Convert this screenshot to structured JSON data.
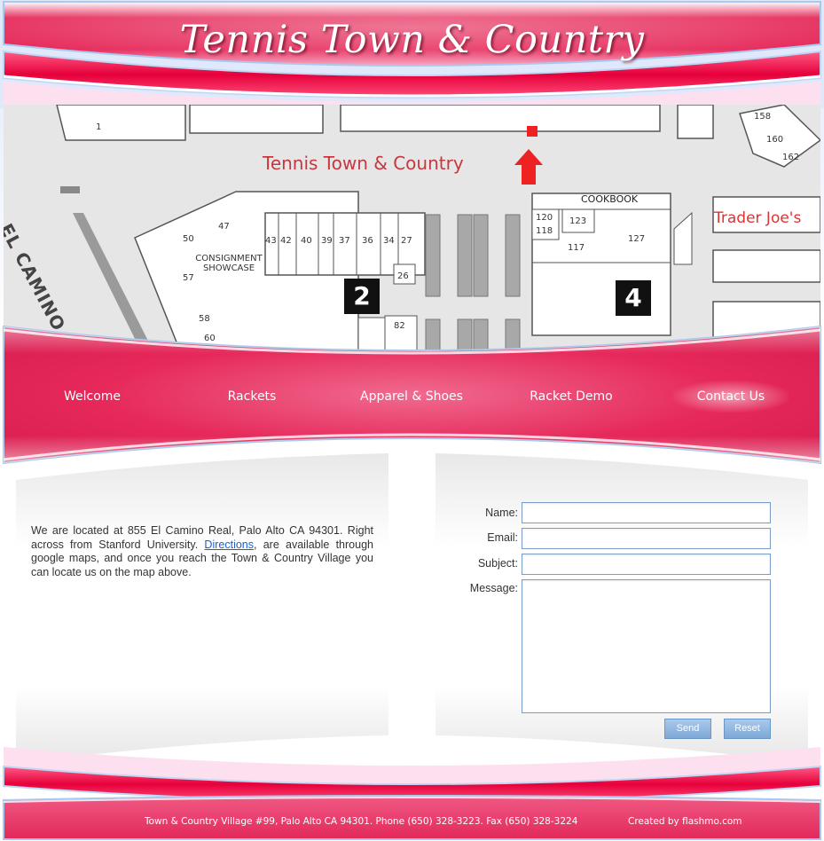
{
  "header": {
    "title": "Tennis Town & Country"
  },
  "map": {
    "store_label": "Tennis Town & Country",
    "trader_joes_label": "Trader Joe's",
    "cookbook_label": "COOKBOOK",
    "consignment_label": "CONSIGNMENT SHOWCASE",
    "road_label": "EL CAMINO",
    "block_2": "2",
    "block_4": "4",
    "units": [
      "1",
      "50",
      "47",
      "43",
      "42",
      "40",
      "39",
      "37",
      "36",
      "34",
      "27",
      "26",
      "57",
      "58",
      "60",
      "82",
      "120",
      "118",
      "123",
      "117",
      "127",
      "158",
      "160",
      "162"
    ]
  },
  "nav": {
    "items": [
      {
        "label": "Welcome"
      },
      {
        "label": "Rackets"
      },
      {
        "label": "Apparel & Shoes"
      },
      {
        "label": "Racket Demo"
      },
      {
        "label": "Contact Us"
      }
    ],
    "active": "Contact Us"
  },
  "about": {
    "text_before": "We are located at 855 El Camino Real, Palo Alto CA 94301. Right across from Stanford University. ",
    "link": "Directions",
    "text_after": ", are available through google maps, and once you reach the Town & Country Village you can locate us on the map above."
  },
  "contact_form": {
    "name_label": "Name:",
    "email_label": "Email:",
    "subject_label": "Subject:",
    "message_label": "Message:",
    "name_value": "",
    "email_value": "",
    "subject_value": "",
    "message_value": "",
    "send_label": "Send",
    "reset_label": "Reset"
  },
  "footer": {
    "address": "Town & Country Village #99, Palo Alto CA 94301. Phone (650) 328-3223. Fax (650) 328-3224",
    "credit": "Created by flashmo.com"
  },
  "colors": {
    "brand_pink": "#e8285a",
    "light_pink": "#fde0ef",
    "border_blue": "#a9c8ee",
    "button_blue": "#8fb4de"
  }
}
